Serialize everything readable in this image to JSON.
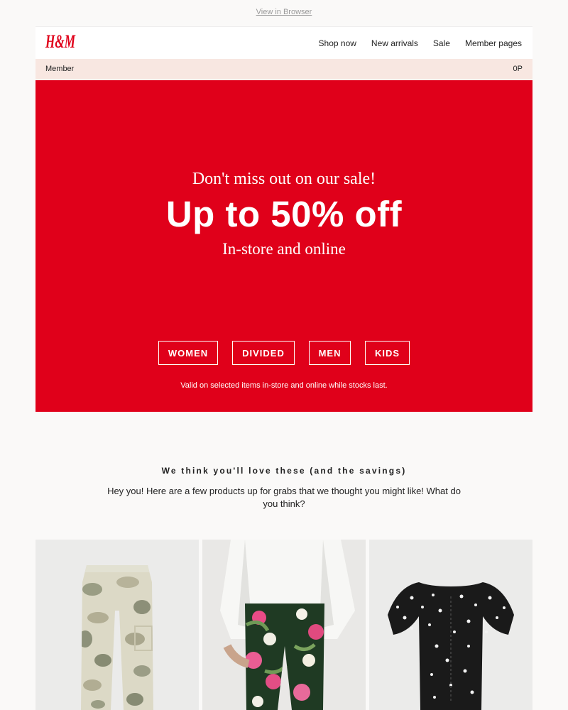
{
  "topbar": {
    "view_in_browser": "View in Browser"
  },
  "header": {
    "logo_text": "H&M",
    "nav": [
      "Shop now",
      "New arrivals",
      "Sale",
      "Member pages"
    ]
  },
  "member_bar": {
    "label": "Member",
    "points": "0P"
  },
  "hero": {
    "kicker": "Don't miss out on our sale!",
    "title": "Up to 50% off",
    "subtitle": "In-store and online",
    "buttons": [
      "WOMEN",
      "DIVIDED",
      "MEN",
      "KIDS"
    ],
    "note": "Valid on selected items in-store and online while stocks last.",
    "background_color": "#e0001a"
  },
  "recommendations": {
    "title": "We think you'll love these (and the savings)",
    "body": "Hey you! Here are a few products up for grabs that we thought you might like! What do you think?"
  },
  "products": [
    {
      "icon": "camo-cargo-pants-image"
    },
    {
      "icon": "floral-print-trousers-image"
    },
    {
      "icon": "black-floral-top-image"
    }
  ],
  "colors": {
    "brand_red": "#e0001a",
    "member_bar": "#f8e7e1"
  }
}
